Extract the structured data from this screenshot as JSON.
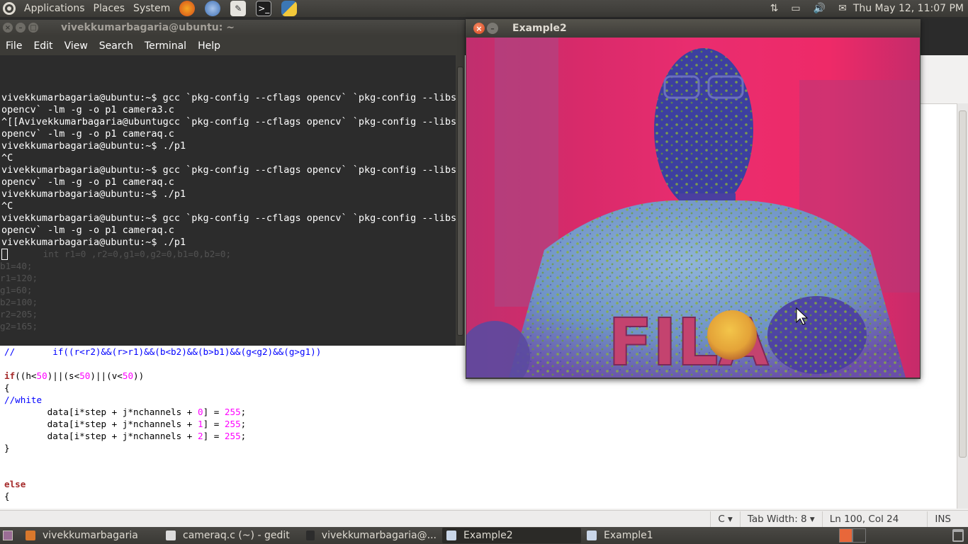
{
  "top_panel": {
    "menus": [
      "Applications",
      "Places",
      "System"
    ],
    "clock": "Thu May 12, 11:07 PM"
  },
  "terminal": {
    "title": "vivekkumarbagaria@ubuntu: ~",
    "menu": [
      "File",
      "Edit",
      "View",
      "Search",
      "Terminal",
      "Help"
    ],
    "lines": [
      "vivekkumarbagaria@ubuntu:~$ gcc `pkg-config --cflags opencv` `pkg-config --libs",
      "opencv` -lm -g -o p1 camera3.c",
      "^[[Avivekkumarbagaria@ubuntugcc `pkg-config --cflags opencv` `pkg-config --libs",
      "opencv` -lm -g -o p1 cameraq.c",
      "vivekkumarbagaria@ubuntu:~$ ./p1",
      "^C",
      "vivekkumarbagaria@ubuntu:~$ gcc `pkg-config --cflags opencv` `pkg-config --libs",
      "opencv` -lm -g -o p1 cameraq.c",
      "vivekkumarbagaria@ubuntu:~$ ./p1",
      "^C",
      "vivekkumarbagaria@ubuntu:~$ gcc `pkg-config --cflags opencv` `pkg-config --libs",
      "opencv` -lm -g -o p1 cameraq.c",
      "vivekkumarbagaria@ubuntu:~$ ./p1"
    ],
    "ghost_lines": [
      "        int r1=0 ,r2=0,g1=0,g2=0,b1=0,b2=0;",
      "b1=40;",
      "r1=120;",
      "g1=60;",
      "b2=100;",
      "r2=205;",
      "g2=165;"
    ]
  },
  "example2": {
    "title": "Example2",
    "image_caption": "FILA"
  },
  "gedit": {
    "code": [
      {
        "type": "comment",
        "text": "//       if((r<r2)&&(r>r1)&&(b<b2)&&(b>b1)&&(g<g2)&&(g>g1))"
      },
      {
        "type": "blank",
        "text": ""
      },
      {
        "type": "if",
        "text": "if((h<50)||(s<50)||(v<50))"
      },
      {
        "type": "plain",
        "text": "{"
      },
      {
        "type": "comment",
        "text": "//white"
      },
      {
        "type": "assign",
        "text": "        data[i*step + j*nchannels + 0] = 255;"
      },
      {
        "type": "assign",
        "text": "        data[i*step + j*nchannels + 1] = 255;"
      },
      {
        "type": "assign",
        "text": "        data[i*step + j*nchannels + 2] = 255;"
      },
      {
        "type": "plain",
        "text": "}"
      },
      {
        "type": "blank",
        "text": ""
      },
      {
        "type": "blank",
        "text": ""
      },
      {
        "type": "else",
        "text": "else"
      },
      {
        "type": "plain",
        "text": "{"
      }
    ],
    "status": {
      "language": "C",
      "tab_width": "Tab Width:  8",
      "position": "Ln 100, Col 24",
      "mode": "INS"
    }
  },
  "taskbar": {
    "tasks": [
      {
        "label": "vivekkumarbagaria",
        "icon_color": "#d9782c",
        "active": false
      },
      {
        "label": "cameraq.c (~) - gedit",
        "icon_color": "#dcdcdc",
        "active": false
      },
      {
        "label": "vivekkumarbagaria@...",
        "icon_color": "#2c2c2c",
        "active": false
      },
      {
        "label": "Example2",
        "icon_color": "#c9d6e8",
        "active": true
      },
      {
        "label": "Example1",
        "icon_color": "#c9d6e8",
        "active": false
      }
    ]
  }
}
